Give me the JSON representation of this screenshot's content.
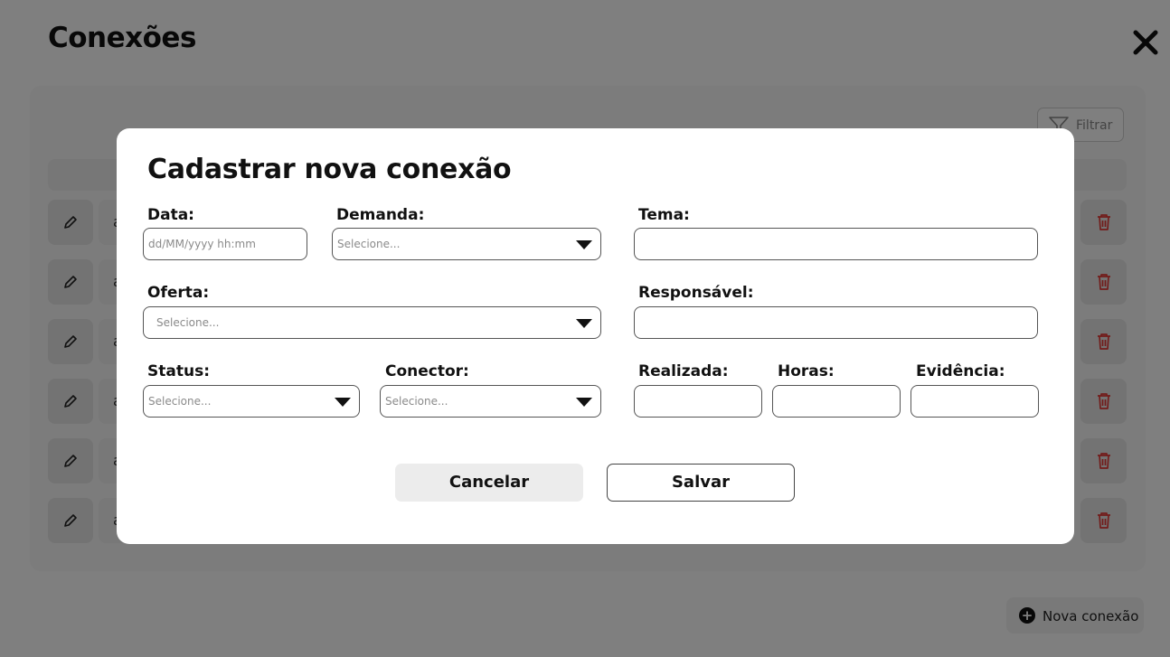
{
  "page": {
    "title": "Conexões",
    "filter_label": "Filtrar",
    "new_connection_label": "Nova conexão",
    "rows": [
      "a",
      "a",
      "a",
      "a",
      "a",
      "a"
    ]
  },
  "modal": {
    "title": "Cadastrar nova conexão",
    "fields": {
      "data": {
        "label": "Data:",
        "placeholder": "dd/MM/yyyy hh:mm"
      },
      "demanda": {
        "label": "Demanda:",
        "placeholder": "Selecione..."
      },
      "tema": {
        "label": "Tema:",
        "value": ""
      },
      "oferta": {
        "label": "Oferta:",
        "placeholder": "Selecione..."
      },
      "responsavel": {
        "label": "Responsável:",
        "value": ""
      },
      "status": {
        "label": "Status:",
        "placeholder": "Selecione..."
      },
      "conector": {
        "label": "Conector:",
        "placeholder": "Selecione..."
      },
      "realizada": {
        "label": "Realizada:",
        "value": ""
      },
      "horas": {
        "label": "Horas:",
        "value": ""
      },
      "evidencia": {
        "label": "Evidência:",
        "value": ""
      }
    },
    "cancel_label": "Cancelar",
    "save_label": "Salvar"
  },
  "colors": {
    "overlay": "#000000",
    "delete_icon": "#e53935",
    "modal_bg": "#ffffff"
  },
  "icons": {
    "close": "close-icon",
    "filter": "filter-icon",
    "edit": "pencil-icon",
    "delete": "trash-icon",
    "add": "plus-circle-icon",
    "select": "caret-down-icon"
  }
}
